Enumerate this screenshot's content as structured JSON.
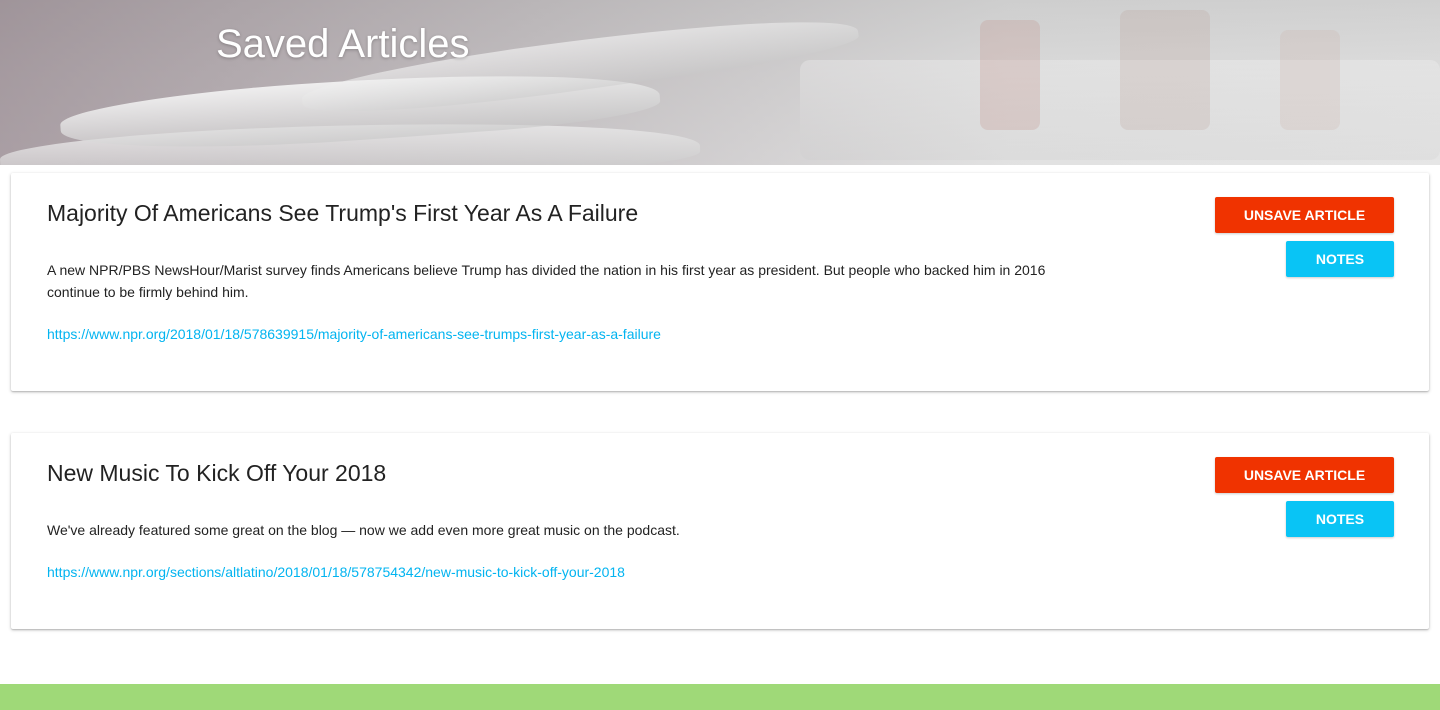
{
  "header": {
    "title": "Saved Articles"
  },
  "articles": [
    {
      "title": "Majority Of Americans See Trump's First Year As A Failure",
      "summary": "A new NPR/PBS NewsHour/Marist survey finds Americans believe Trump has divided the nation in his first year as president. But people who backed him in 2016 continue to be firmly behind him.",
      "url": "https://www.npr.org/2018/01/18/578639915/majority-of-americans-see-trumps-first-year-as-a-failure",
      "unsave_label": "Unsave Article",
      "notes_label": "Notes"
    },
    {
      "title": "New Music To Kick Off Your 2018",
      "summary": "We've already featured some great on the blog — now we add even more great music on the podcast.",
      "url": "https://www.npr.org/sections/altlatino/2018/01/18/578754342/new-music-to-kick-off-your-2018",
      "unsave_label": "Unsave Article",
      "notes_label": "Notes"
    }
  ],
  "colors": {
    "unsave": "#f03300",
    "notes": "#09c4f5",
    "link": "#03b4f0",
    "footer": "#9fd978"
  }
}
